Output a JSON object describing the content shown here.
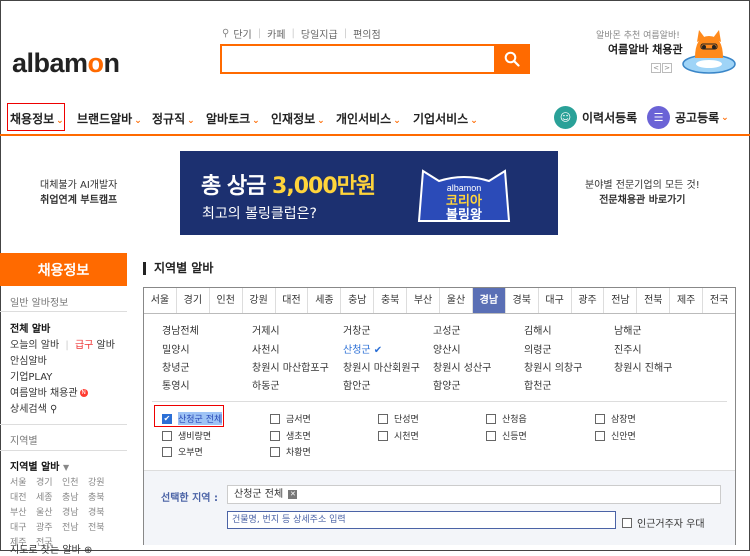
{
  "header": {
    "logo": {
      "pre": "albam",
      "o": "o",
      "post": "n"
    },
    "quick_links": [
      "단기",
      "카페",
      "당일지급",
      "편의점"
    ],
    "search": {
      "placeholder": "",
      "value": ""
    },
    "promo": {
      "small": "알바몬 추천 여름알바!",
      "big": "여름알바 채용관",
      "prev": "<",
      "next": ">"
    }
  },
  "nav": {
    "items": [
      "채용정보",
      "브랜드알바",
      "정규직",
      "알바토크",
      "인재정보",
      "개인서비스",
      "기업서비스"
    ],
    "chevron": "⌄",
    "resume": "이력서등록",
    "post": "공고등록"
  },
  "banner": {
    "left": [
      "대체불가 AI개발자",
      "취업연계 부트캠프"
    ],
    "title_white": "총 상금 ",
    "title_yellow": "3,000만원",
    "subtitle": "최고의 볼링클럽은?",
    "badge_brand": "albamon",
    "badge_line1": "코리아",
    "badge_line2": "볼링왕",
    "right": [
      "분야별 전문기업의 모든 것!",
      "전문채용관 바로가기"
    ]
  },
  "sidebar": {
    "head": "채용정보",
    "section1": "일반 알바정보",
    "links": [
      {
        "text": "전체 알바",
        "bold": true
      },
      {
        "text": "오늘의 알바"
      },
      {
        "text": "급구 알바"
      },
      {
        "text": "안심알바"
      },
      {
        "text": "기업PLAY"
      },
      {
        "text": "여름알바 채용관"
      },
      {
        "text": "상세검색"
      }
    ],
    "section2": "지역별",
    "region_title": "지역별 알바",
    "regions": [
      "서울",
      "경기",
      "인천",
      "강원",
      "대전",
      "세종",
      "충남",
      "충북",
      "부산",
      "울산",
      "경남",
      "경북",
      "대구",
      "광주",
      "전남",
      "전북",
      "제주",
      "전국"
    ],
    "bottom": "지도로 찾는 알바"
  },
  "main": {
    "title": "지역별 알바",
    "tabs": [
      "서울",
      "경기",
      "인천",
      "강원",
      "대전",
      "세종",
      "충남",
      "충북",
      "부산",
      "울산",
      "경남",
      "경북",
      "대구",
      "광주",
      "전남",
      "전북",
      "제주",
      "전국"
    ],
    "active_tab": "경남",
    "subregions": [
      "경남전체",
      "거제시",
      "거창군",
      "고성군",
      "김해시",
      "남해군",
      "밀양시",
      "사천시",
      "산청군",
      "양산시",
      "의령군",
      "진주시",
      "창녕군",
      "창원시 마산합포구",
      "창원시 마산회원구",
      "창원시 성산구",
      "창원시 의창구",
      "창원시 진해구",
      "통영시",
      "하동군",
      "함안군",
      "함양군",
      "합천군"
    ],
    "selected_subregion": "산청군",
    "checks": [
      {
        "label": "산청군 전체",
        "checked": true
      },
      {
        "label": "금서면",
        "checked": false
      },
      {
        "label": "단성면",
        "checked": false
      },
      {
        "label": "산청읍",
        "checked": false
      },
      {
        "label": "삼장면",
        "checked": false
      },
      {
        "label": "생비량면",
        "checked": false
      },
      {
        "label": "생초면",
        "checked": false
      },
      {
        "label": "시천면",
        "checked": false
      },
      {
        "label": "신등면",
        "checked": false
      },
      {
        "label": "신안면",
        "checked": false
      },
      {
        "label": "오부면",
        "checked": false
      },
      {
        "label": "차황면",
        "checked": false
      }
    ],
    "selected_label": "선택한 지역 :",
    "selected_value": "산청군 전체",
    "address_placeholder": "건물명, 번지 등 상세주소 입력",
    "near_label": "인근거주자 우대"
  },
  "colors": {
    "accent": "#ff6a00",
    "tab_active": "#5a6fb5",
    "highlight": "#e00000",
    "banner_bg": "#1c3070"
  }
}
